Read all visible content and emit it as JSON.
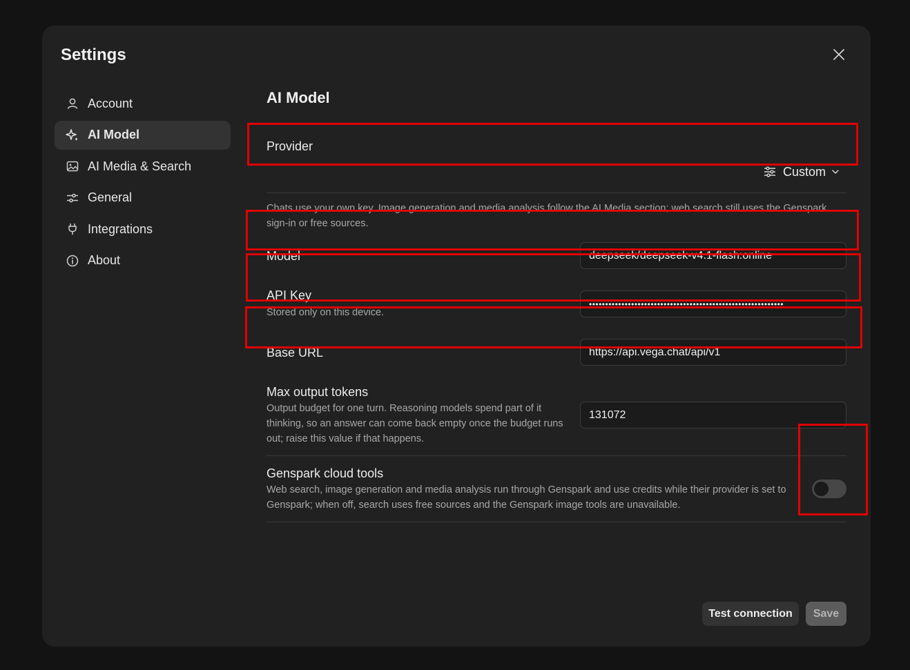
{
  "dialog": {
    "title": "Settings"
  },
  "sidebar": {
    "items": [
      {
        "label": "Account",
        "icon": "user-icon"
      },
      {
        "label": "AI Model",
        "icon": "sparkle-icon",
        "active": true
      },
      {
        "label": "AI Media & Search",
        "icon": "image-icon"
      },
      {
        "label": "General",
        "icon": "sliders-icon"
      },
      {
        "label": "Integrations",
        "icon": "plug-icon"
      },
      {
        "label": "About",
        "icon": "info-icon"
      }
    ]
  },
  "main": {
    "section_title": "AI Model",
    "provider": {
      "label": "Provider",
      "value": "Custom"
    },
    "provider_note": "Chats use your own key. Image generation and media analysis follow the AI Media section; web search still uses the Genspark sign-in or free sources.",
    "model": {
      "label": "Model",
      "value": "deepseek/deepseek-v4.1-flash:online"
    },
    "api_key": {
      "label": "API Key",
      "desc": "Stored only on this device.",
      "value": "••••••••••••••••••••••••••••••••••••••••••••••••••••••••••••"
    },
    "base_url": {
      "label": "Base URL",
      "value": "https://api.vega.chat/api/v1"
    },
    "max_tokens": {
      "label": "Max output tokens",
      "desc": "Output budget for one turn. Reasoning models spend part of it thinking, so an answer can come back empty once the budget runs out; raise this value if that happens.",
      "value": "131072"
    },
    "cloud_tools": {
      "label": "Genspark cloud tools",
      "desc": "Web search, image generation and media analysis run through Genspark and use credits while their provider is set to Genspark; when off, search uses free sources and the Genspark image tools are unavailable.",
      "enabled": false
    }
  },
  "footer": {
    "test_label": "Test connection",
    "save_label": "Save"
  },
  "colors": {
    "highlight": "#e10000",
    "modal_bg": "#212121"
  }
}
